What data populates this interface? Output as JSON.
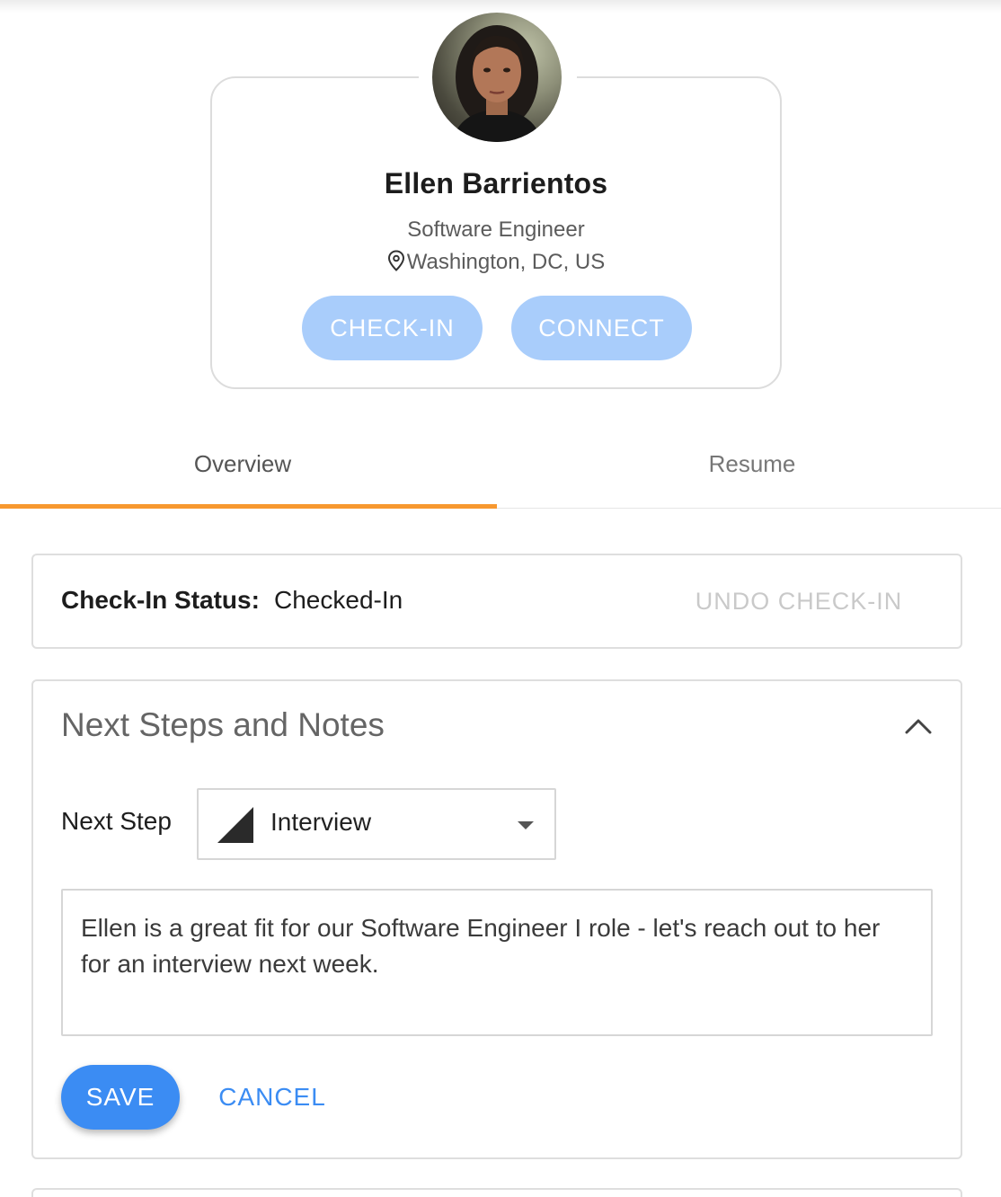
{
  "profile": {
    "name": "Ellen Barrientos",
    "title": "Software Engineer",
    "location": "Washington, DC, US",
    "avatar_icon": "person-photo",
    "check_in_label": "CHECK-IN",
    "connect_label": "CONNECT"
  },
  "tabs": [
    {
      "label": "Overview",
      "active": true
    },
    {
      "label": "Resume",
      "active": false
    }
  ],
  "check_in": {
    "label": "Check-In Status:",
    "value": "Checked-In",
    "undo_label": "UNDO CHECK-IN"
  },
  "notes": {
    "heading": "Next Steps and Notes",
    "next_step_label": "Next Step",
    "next_step_value": "Interview",
    "note_text": "Ellen is a great fit for our Software Engineer I role - let's reach out to her for an interview next week.",
    "save_label": "SAVE",
    "cancel_label": "CANCEL"
  },
  "colors": {
    "accent": "#3b8cf3",
    "disabled_button": "#a9cdfb",
    "tab_indicator": "#f7982f"
  }
}
